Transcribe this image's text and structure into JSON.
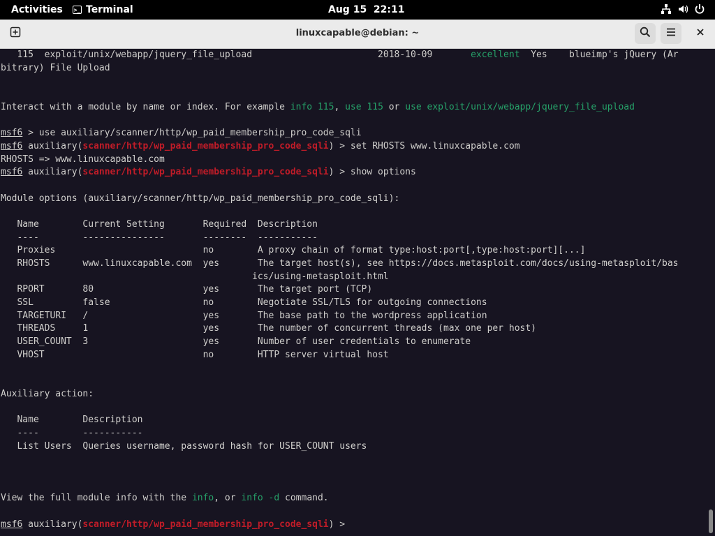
{
  "topbar": {
    "activities": "Activities",
    "app_name": "Terminal",
    "clock": "Aug 15  22:11"
  },
  "window": {
    "title": "linuxcapable@debian: ~"
  },
  "terminal": {
    "lines": [
      [
        {
          "t": "   115  exploit/unix/webapp/jquery_file_upload                       2018-10-09       "
        },
        {
          "t": "excellent",
          "c": "g"
        },
        {
          "t": "  Yes    blueimp's jQuery (Ar"
        }
      ],
      [
        {
          "t": "bitrary) File Upload"
        }
      ],
      [],
      [],
      [
        {
          "t": "Interact with a module by name or index. For example "
        },
        {
          "t": "info 115",
          "c": "g"
        },
        {
          "t": ", "
        },
        {
          "t": "use 115",
          "c": "g"
        },
        {
          "t": " or "
        },
        {
          "t": "use exploit/unix/webapp/jquery_file_upload",
          "c": "g"
        }
      ],
      [],
      [
        {
          "t": "msf6",
          "c": "u"
        },
        {
          "t": " > use auxiliary/scanner/http/wp_paid_membership_pro_code_sqli"
        }
      ],
      [
        {
          "t": "msf6",
          "c": "u"
        },
        {
          "t": " auxiliary("
        },
        {
          "t": "scanner/http/wp_paid_membership_pro_code_sqli",
          "c": "r"
        },
        {
          "t": ") > set RHOSTS www.linuxcapable.com"
        }
      ],
      [
        {
          "t": "RHOSTS => www.linuxcapable.com"
        }
      ],
      [
        {
          "t": "msf6",
          "c": "u"
        },
        {
          "t": " auxiliary("
        },
        {
          "t": "scanner/http/wp_paid_membership_pro_code_sqli",
          "c": "r"
        },
        {
          "t": ") > show options"
        }
      ],
      [],
      [
        {
          "t": "Module options (auxiliary/scanner/http/wp_paid_membership_pro_code_sqli):"
        }
      ],
      [],
      [
        {
          "t": "   Name        Current Setting       Required  Description"
        }
      ],
      [
        {
          "t": "   ----        ---------------       --------  -----------"
        }
      ],
      [
        {
          "t": "   Proxies                           no        A proxy chain of format type:host:port[,type:host:port][...]"
        }
      ],
      [
        {
          "t": "   RHOSTS      www.linuxcapable.com  yes       The target host(s), see https://docs.metasploit.com/docs/using-metasploit/bas"
        }
      ],
      [
        {
          "t": "                                              ics/using-metasploit.html"
        }
      ],
      [
        {
          "t": "   RPORT       80                    yes       The target port (TCP)"
        }
      ],
      [
        {
          "t": "   SSL         false                 no        Negotiate SSL/TLS for outgoing connections"
        }
      ],
      [
        {
          "t": "   TARGETURI   /                     yes       The base path to the wordpress application"
        }
      ],
      [
        {
          "t": "   THREADS     1                     yes       The number of concurrent threads (max one per host)"
        }
      ],
      [
        {
          "t": "   USER_COUNT  3                     yes       Number of user credentials to enumerate"
        }
      ],
      [
        {
          "t": "   VHOST                             no        HTTP server virtual host"
        }
      ],
      [],
      [],
      [
        {
          "t": "Auxiliary action:"
        }
      ],
      [],
      [
        {
          "t": "   Name        Description"
        }
      ],
      [
        {
          "t": "   ----        -----------"
        }
      ],
      [
        {
          "t": "   List Users  Queries username, password hash for USER_COUNT users"
        }
      ],
      [],
      [],
      [],
      [
        {
          "t": "View the full module info with the "
        },
        {
          "t": "info",
          "c": "g"
        },
        {
          "t": ", or "
        },
        {
          "t": "info -d",
          "c": "g"
        },
        {
          "t": " command."
        }
      ],
      [],
      [
        {
          "t": "msf6",
          "c": "u"
        },
        {
          "t": " auxiliary("
        },
        {
          "t": "scanner/http/wp_paid_membership_pro_code_sqli",
          "c": "r"
        },
        {
          "t": ") > "
        }
      ]
    ]
  },
  "icons": {
    "newtab": "new-tab-icon",
    "search": "search-icon",
    "menu": "hamburger-menu-icon",
    "close": "close-icon",
    "network": "network-icon",
    "volume": "volume-icon",
    "power": "power-icon"
  },
  "colors": {
    "terminal_bg": "#171421",
    "terminal_fg": "#d0cfcc",
    "green": "#26a269",
    "red": "#c01c28"
  }
}
